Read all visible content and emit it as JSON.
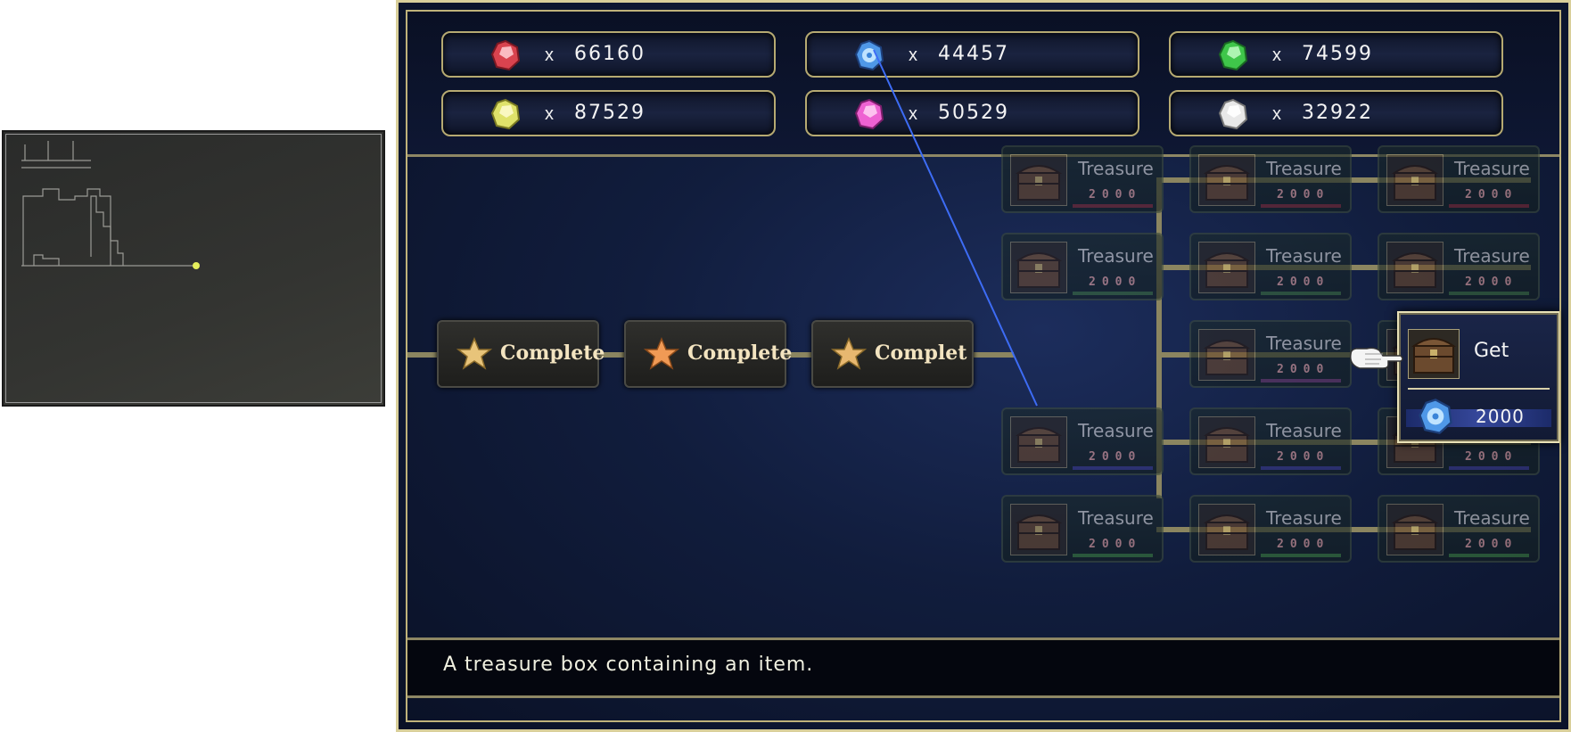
{
  "minimap": {
    "label": "minimap"
  },
  "currencies": [
    {
      "gem": "red-gem-icon",
      "color": "#e0505a",
      "x_mark": "x",
      "count": "66160"
    },
    {
      "gem": "blue-gem-icon",
      "color": "#58a8f0",
      "x_mark": "x",
      "count": "44457"
    },
    {
      "gem": "green-gem-icon",
      "color": "#52d65a",
      "x_mark": "x",
      "count": "74599"
    },
    {
      "gem": "yellow-gem-icon",
      "color": "#e6e870",
      "x_mark": "x",
      "count": "87529"
    },
    {
      "gem": "pink-gem-icon",
      "color": "#f070d8",
      "x_mark": "x",
      "count": "50529"
    },
    {
      "gem": "white-gem-icon",
      "color": "#e6e6e6",
      "x_mark": "x",
      "count": "32922"
    }
  ],
  "complete_nodes": [
    {
      "label": "Complete"
    },
    {
      "label": "Complete"
    },
    {
      "label": "Complet"
    }
  ],
  "treasure_nodes": {
    "label": "Treasure",
    "cost": "2000"
  },
  "selected_node": {
    "action_label": "Get",
    "cost": "2000",
    "cost_gem": "blue-gem-icon"
  },
  "description": "A treasure box containing an item.",
  "colors": {
    "frame_gold": "#d9cf9a",
    "background_navy": "#0d1630",
    "complete_star": "#f0b060",
    "laser": "#3d6cf5"
  }
}
